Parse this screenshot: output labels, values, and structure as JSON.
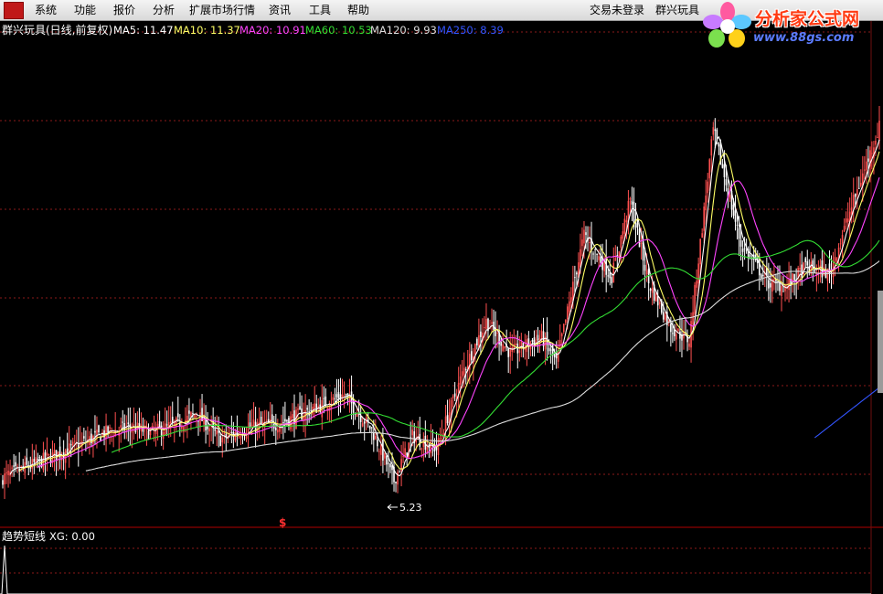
{
  "menubar": {
    "logo_text": "",
    "items": [
      "系统",
      "功能",
      "报价",
      "分析",
      "扩展市场行情",
      "资讯",
      "工具",
      "帮助"
    ],
    "login_status": "交易未登录",
    "stock_short": "群兴玩具"
  },
  "brand": {
    "title": "分析家公式网",
    "url": "www.88gs.com"
  },
  "main_panel": {
    "title": "群兴玩具(日线,前复权)",
    "ma": [
      {
        "label": "MA5: 11.47",
        "color": "#ffffff"
      },
      {
        "label": "MA10: 11.37",
        "color": "#ffff66"
      },
      {
        "label": "MA20: 10.91",
        "color": "#ff44ff"
      },
      {
        "label": "MA60: 10.53",
        "color": "#33dd33"
      },
      {
        "label": "MA120: 9.93",
        "color": "#dddddd"
      },
      {
        "label": "MA250: 8.39",
        "color": "#3355ff"
      }
    ],
    "min_label": "5.23",
    "signal_mark": "$"
  },
  "sub_panel": {
    "title": "趋势短线",
    "indicator": "XG: 0.00"
  },
  "colors": {
    "up": "#ff5050",
    "down": "#ffffff",
    "grid": "#8b1a1a",
    "axis": "#b00000"
  },
  "chart_data": {
    "type": "candlestick",
    "series": [
      {
        "name": "MA5",
        "values": []
      },
      {
        "name": "MA10",
        "values": []
      },
      {
        "name": "MA20",
        "values": []
      },
      {
        "name": "MA60",
        "values": []
      },
      {
        "name": "MA120",
        "values": []
      },
      {
        "name": "MA250",
        "values": []
      }
    ],
    "price_waypoints": [
      [
        0,
        5.9
      ],
      [
        20,
        6.4
      ],
      [
        40,
        6.9
      ],
      [
        55,
        7.3
      ],
      [
        70,
        7.5
      ],
      [
        80,
        7.3
      ],
      [
        95,
        7.6
      ],
      [
        105,
        7.9
      ],
      [
        118,
        7.1
      ],
      [
        135,
        7.5
      ],
      [
        150,
        7.6
      ],
      [
        170,
        8.1
      ],
      [
        185,
        8.5
      ],
      [
        200,
        7.4
      ],
      [
        212,
        5.8
      ],
      [
        222,
        7.2
      ],
      [
        235,
        6.8
      ],
      [
        250,
        9.3
      ],
      [
        262,
        10.8
      ],
      [
        275,
        9.8
      ],
      [
        292,
        10.3
      ],
      [
        300,
        9.5
      ],
      [
        315,
        13.5
      ],
      [
        330,
        12.2
      ],
      [
        340,
        14.6
      ],
      [
        350,
        12.0
      ],
      [
        362,
        10.6
      ],
      [
        372,
        10.2
      ],
      [
        385,
        16.8
      ],
      [
        400,
        13.2
      ],
      [
        415,
        12.0
      ],
      [
        425,
        11.9
      ],
      [
        435,
        12.5
      ],
      [
        448,
        12.3
      ],
      [
        460,
        14.4
      ],
      [
        475,
        16.9
      ]
    ],
    "y_range": [
      4.6,
      19.5
    ],
    "min_price": 5.23
  }
}
